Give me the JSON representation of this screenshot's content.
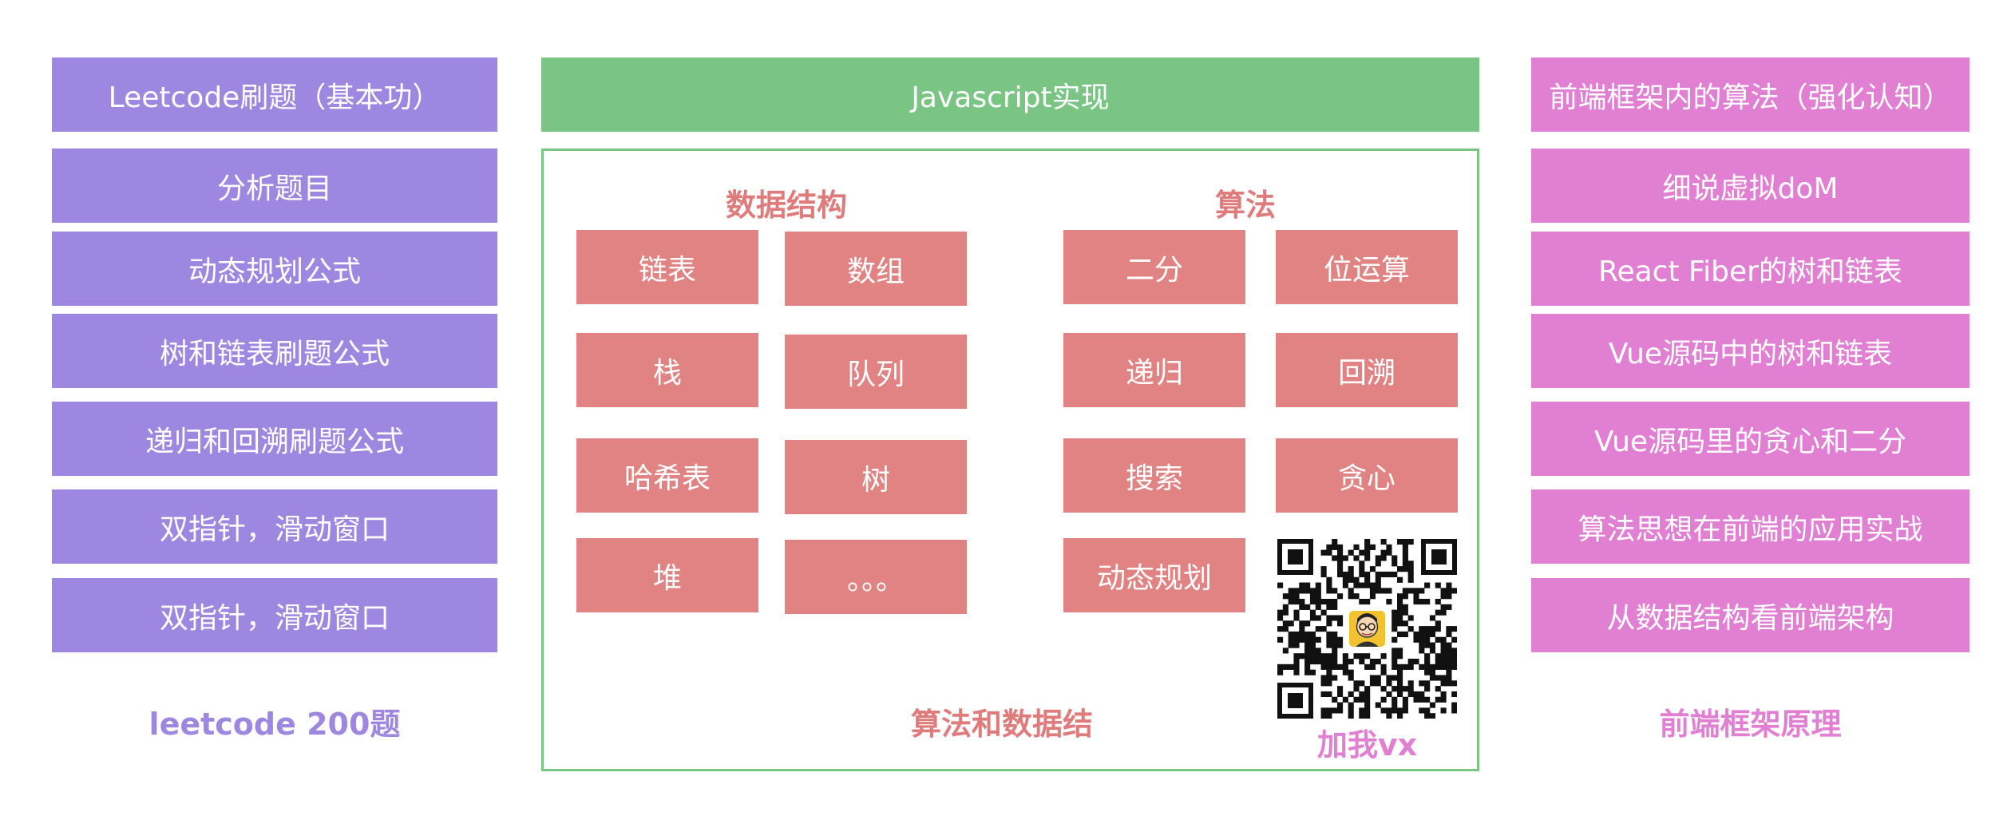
{
  "left": {
    "header": "Leetcode刷题（基本功）",
    "items": [
      "分析题目",
      "动态规划公式",
      "树和链表刷题公式",
      "递归和回溯刷题公式",
      "双指针，滑动窗口",
      "双指针，滑动窗口"
    ],
    "caption": "leetcode 200题"
  },
  "center": {
    "header": "Javascript实现",
    "data_structures": {
      "title": "数据结构",
      "items": [
        "链表",
        "数组",
        "栈",
        "队列",
        "哈希表",
        "树",
        "堆",
        "。。。"
      ]
    },
    "algorithms": {
      "title": "算法",
      "items": [
        "二分",
        "位运算",
        "递归",
        "回溯",
        "搜索",
        "贪心",
        "动态规划"
      ]
    },
    "caption": "算法和数据结",
    "qr_caption": "加我vx",
    "qr_icon": "qr-code-with-avatar"
  },
  "right": {
    "header": "前端框架内的算法（强化认知）",
    "items": [
      "细说虚拟doM",
      "React Fiber的树和链表",
      "Vue源码中的树和链表",
      "Vue源码里的贪心和二分",
      "算法思想在前端的应用实战",
      "从数据结构看前端架构"
    ],
    "caption": "前端框架原理"
  },
  "colors": {
    "purple": "#9e87e0",
    "pink": "#e17fd3",
    "green": "#7ac584",
    "red": "#e28383",
    "red_text": "#e07b7b"
  }
}
